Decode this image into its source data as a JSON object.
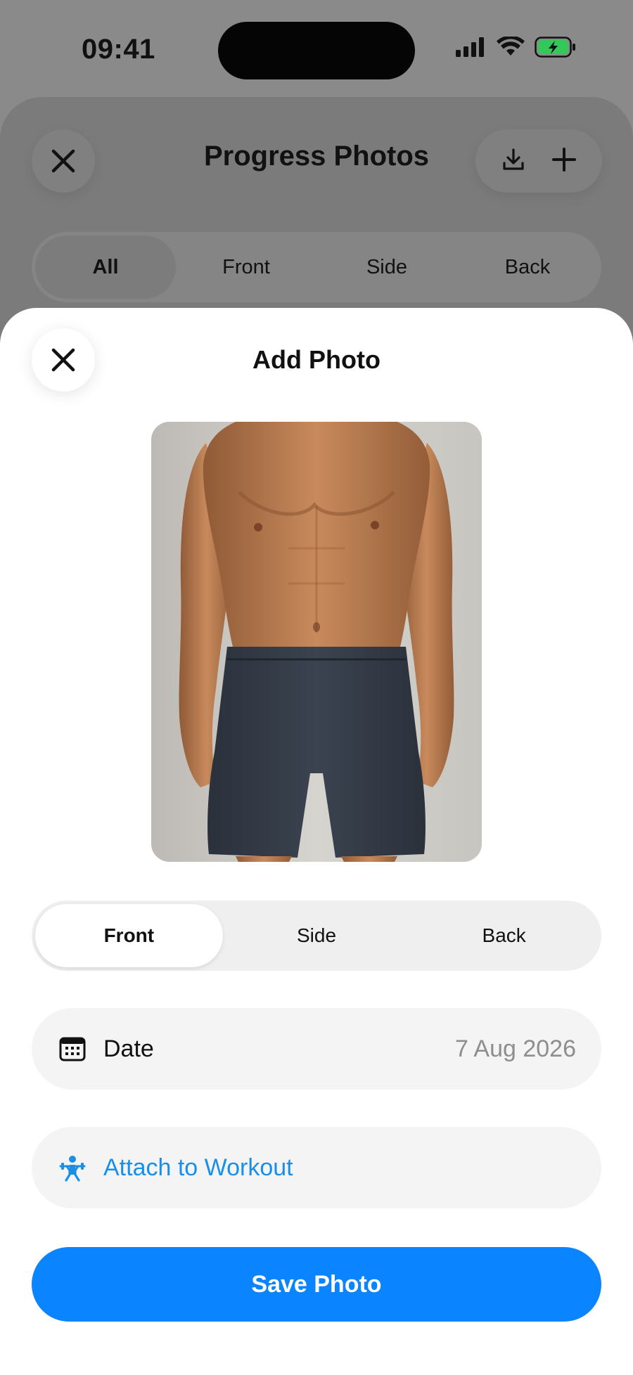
{
  "status_bar": {
    "time": "09:41"
  },
  "background_screen": {
    "title": "Progress Photos",
    "tabs": [
      {
        "label": "All",
        "active": true
      },
      {
        "label": "Front",
        "active": false
      },
      {
        "label": "Side",
        "active": false
      },
      {
        "label": "Back",
        "active": false
      }
    ]
  },
  "modal": {
    "title": "Add Photo",
    "pose_options": [
      {
        "label": "Front",
        "active": true
      },
      {
        "label": "Side",
        "active": false
      },
      {
        "label": "Back",
        "active": false
      }
    ],
    "date_row": {
      "label": "Date",
      "value": "7 Aug 2026",
      "icon": "calendar-icon"
    },
    "attach_row": {
      "label": "Attach to Workout",
      "icon": "weightlifter-icon"
    },
    "save_button": "Save Photo"
  },
  "colors": {
    "accent": "#0a84ff",
    "link": "#1a8fe8",
    "battery": "#34c759"
  }
}
